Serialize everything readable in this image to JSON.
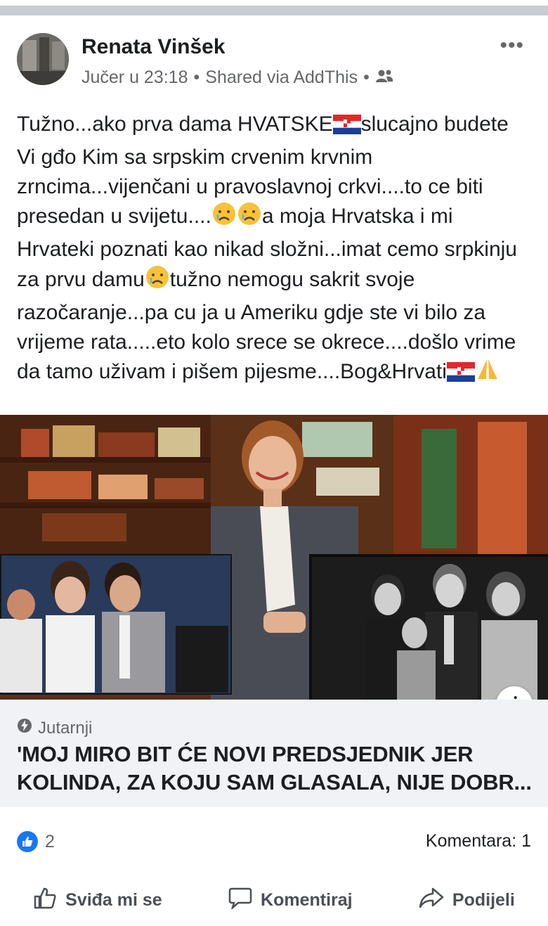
{
  "post": {
    "author": "Renata Vinšek",
    "timestamp": "Jučer u 23:18",
    "separator": "•",
    "shared_via": "Shared via AddThis",
    "privacy_icon": "friends-icon",
    "more_label": "•••",
    "text_parts": {
      "p1": "Tužno...ako prva dama HVATSKE",
      "p2": "slucajno budete  Vi gđo Kim sa srpskim crvenim krvnim zrncima...vijenčani u pravoslavnoj crkvi....to ce biti presedan u svijetu....",
      "p3": "a moja Hrvatska i mi Hrvateki poznati kao nikad složni...imat cemo srpkinju za prvu damu",
      "p4": "tužno nemogu sakrit svoje razočaranje...pa cu ja u Ameriku gdje ste vi bilo za vrijeme rata.....eto kolo srece se okrece....došlo vrime da tamo uživam i pišem pijesme....Bog&Hrvati"
    }
  },
  "link_preview": {
    "info_label": "i",
    "source": "Jutarnji",
    "title": "'MOJ MIRO BIT ĆE NOVI PREDSJEDNIK JER KOLINDA, ZA KOJU SAM GLASALA, NIJE DOBR..."
  },
  "engagement": {
    "likes_count": "2",
    "comments_label": "Komentara: 1"
  },
  "actions": {
    "like": "Sviđa mi se",
    "comment": "Komentiraj",
    "share": "Podijeli"
  },
  "colors": {
    "accent": "#1877f2",
    "secondary_text": "#65676b",
    "link_box_bg": "#f0f2f5"
  }
}
